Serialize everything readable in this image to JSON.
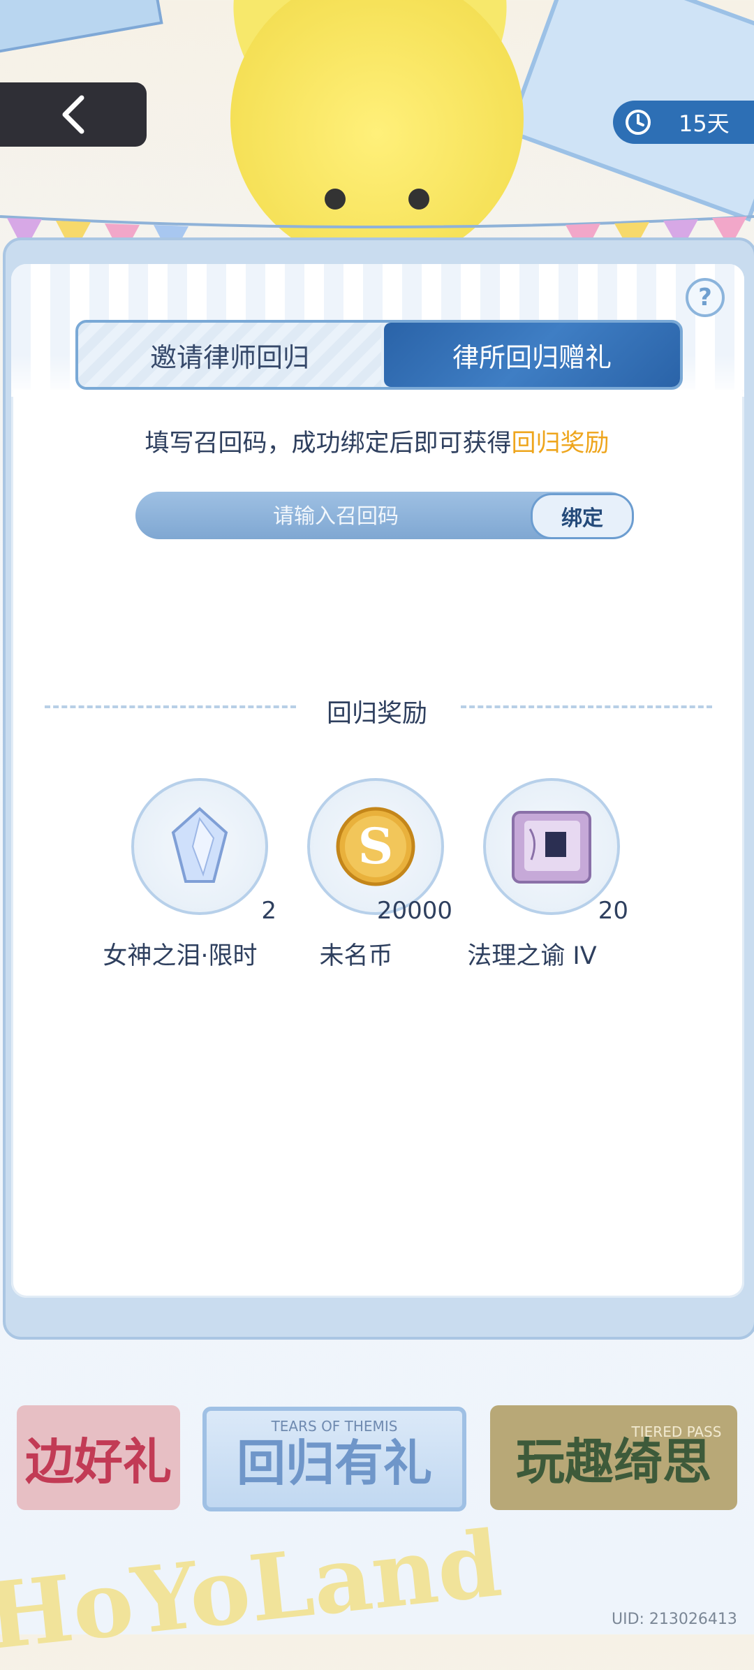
{
  "header": {
    "back_label": "<",
    "timer_text": "15天"
  },
  "tabs": [
    {
      "label": "邀请律师回归",
      "active": false
    },
    {
      "label": "律所回归赠礼",
      "active": true
    }
  ],
  "instruction": {
    "text": "填写召回码，成功绑定后即可获得",
    "highlight": "回归奖励"
  },
  "code_form": {
    "placeholder": "请输入召回码",
    "bind_label": "绑定"
  },
  "rewards_section": {
    "title": "回归奖励",
    "items": [
      {
        "name": "女神之泪·限时",
        "qty": "2",
        "icon": "tear-crystal-icon"
      },
      {
        "name": "未名币",
        "qty": "20000",
        "icon": "coin-icon"
      },
      {
        "name": "法理之谕 IV",
        "qty": "20",
        "icon": "law-book-icon"
      }
    ]
  },
  "banners": [
    {
      "label": "边好礼",
      "sub": ""
    },
    {
      "label": "回归有礼",
      "sub": "TEARS OF THEMIS"
    },
    {
      "label": "玩趣绮思",
      "sub": "TIERED PASS"
    }
  ],
  "footer": {
    "watermark": "HoYoLand",
    "uid": "UID: 213026413"
  },
  "colors": {
    "accent_blue": "#2d6fb5",
    "highlight_orange": "#eea51c",
    "text_dark": "#2e3f5e"
  }
}
